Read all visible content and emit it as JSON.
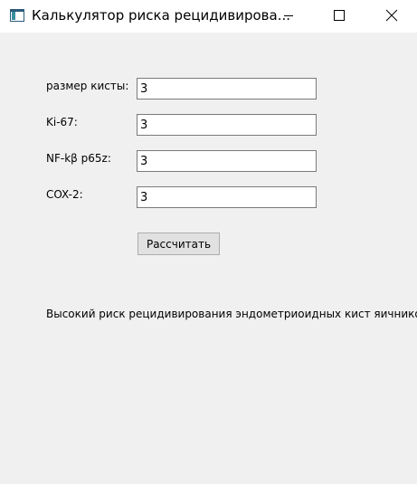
{
  "window": {
    "title": "Калькулятор риска рецидивирова...",
    "icon": "app-window-icon",
    "controls": [
      "minimize-icon",
      "maximize-icon",
      "close-icon"
    ]
  },
  "form": {
    "fields": [
      {
        "label": "размер кисты:",
        "value": "3"
      },
      {
        "label": "Ki-67:",
        "value": "3"
      },
      {
        "label": "NF-kβ p65z:",
        "value": "3"
      },
      {
        "label": "COX-2:",
        "value": "3"
      }
    ],
    "calculate_label": "Рассчитать"
  },
  "result": {
    "text": "Высокий риск рецидивирования эндометриоидных кист яичников"
  }
}
